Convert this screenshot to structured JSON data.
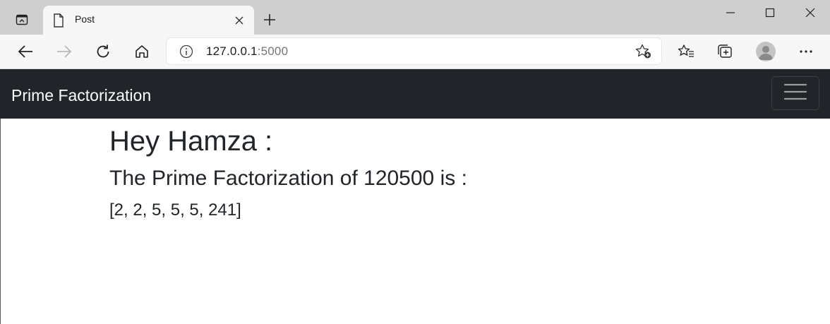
{
  "browser": {
    "tab": {
      "title": "Post"
    },
    "address": {
      "host": "127.0.0.1",
      "port": ":5000"
    },
    "icons": {
      "tab_actions": "tab-actions-icon",
      "page": "page-icon",
      "close": "close-icon",
      "new_tab": "plus-icon",
      "minimize": "minimize-icon",
      "maximize": "maximize-icon",
      "close_window": "close-window-icon",
      "back": "back-arrow-icon",
      "forward": "forward-arrow-icon",
      "refresh": "refresh-icon",
      "home": "home-icon",
      "info": "info-icon",
      "add_favorite": "star-plus-icon",
      "favorites": "favorites-icon",
      "collections": "collections-icon",
      "profile": "profile-avatar",
      "more": "more-icon"
    }
  },
  "navbar": {
    "brand": "Prime Factorization",
    "toggler_icon": "hamburger-icon",
    "background": "#212529"
  },
  "main": {
    "greeting": "Hey Hamza :",
    "result_heading": "The Prime Factorization of 120500 is :",
    "factors": "[2, 2, 5, 5, 5, 241]"
  }
}
